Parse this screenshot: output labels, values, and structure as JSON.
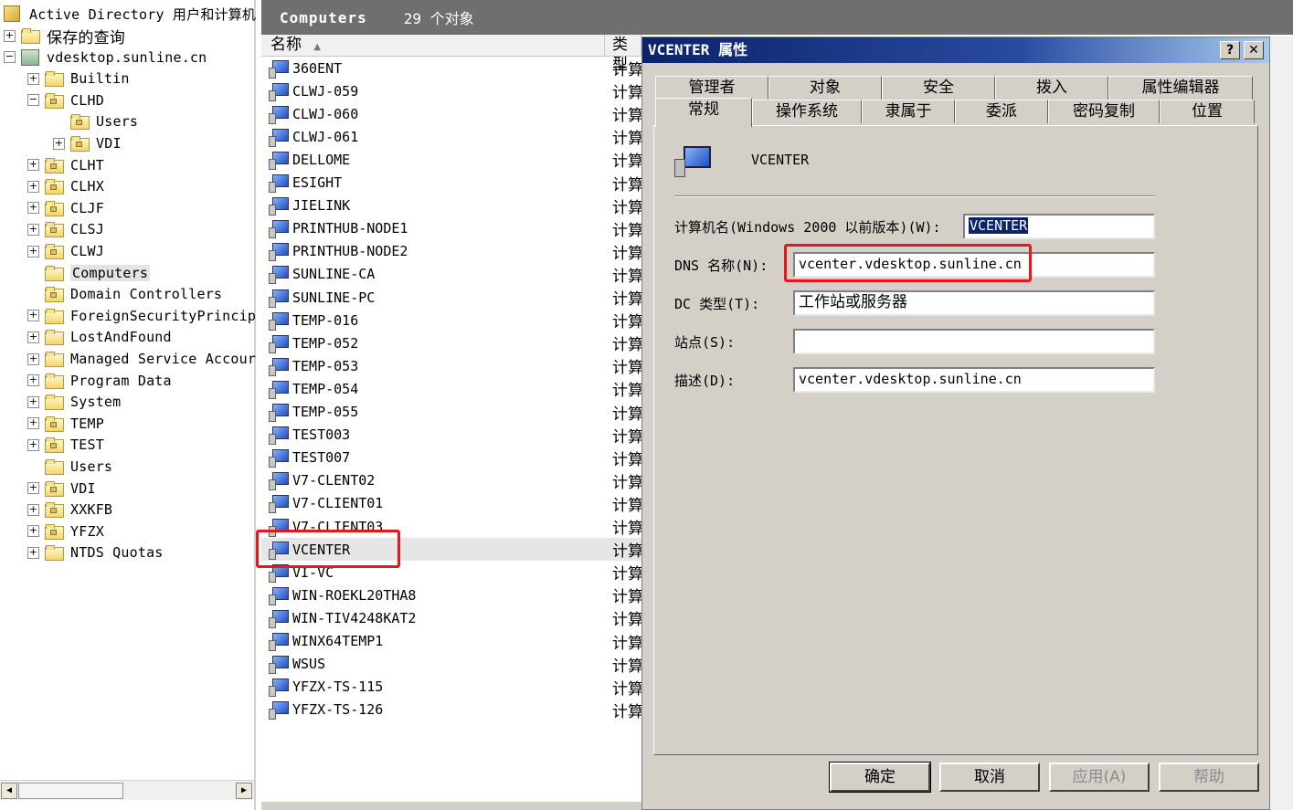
{
  "tree": {
    "root_label": "Active Directory 用户和计算机",
    "items": [
      {
        "label": "保存的查询",
        "exp": "+",
        "indent": 0,
        "icon": "folder-icon"
      },
      {
        "label": "vdesktop.sunline.cn",
        "exp": "-",
        "indent": 0,
        "icon": "domain-icon"
      },
      {
        "label": "Builtin",
        "exp": "+",
        "indent": 1,
        "icon": "folder-icon"
      },
      {
        "label": "CLHD",
        "exp": "-",
        "indent": 1,
        "icon": "ou-icon"
      },
      {
        "label": "Users",
        "exp": "",
        "indent": 2,
        "icon": "ou-icon"
      },
      {
        "label": "VDI",
        "exp": "+",
        "indent": 2,
        "icon": "ou-icon"
      },
      {
        "label": "CLHT",
        "exp": "+",
        "indent": 1,
        "icon": "ou-icon"
      },
      {
        "label": "CLHX",
        "exp": "+",
        "indent": 1,
        "icon": "ou-icon"
      },
      {
        "label": "CLJF",
        "exp": "+",
        "indent": 1,
        "icon": "ou-icon"
      },
      {
        "label": "CLSJ",
        "exp": "+",
        "indent": 1,
        "icon": "ou-icon"
      },
      {
        "label": "CLWJ",
        "exp": "+",
        "indent": 1,
        "icon": "ou-icon"
      },
      {
        "label": "Computers",
        "exp": "",
        "indent": 1,
        "icon": "folder-icon",
        "selected": true
      },
      {
        "label": "Domain Controllers",
        "exp": "",
        "indent": 1,
        "icon": "ou-icon"
      },
      {
        "label": "ForeignSecurityPrincip",
        "exp": "+",
        "indent": 1,
        "icon": "folder-icon"
      },
      {
        "label": "LostAndFound",
        "exp": "+",
        "indent": 1,
        "icon": "folder-icon"
      },
      {
        "label": "Managed Service Accour",
        "exp": "+",
        "indent": 1,
        "icon": "folder-icon"
      },
      {
        "label": "Program Data",
        "exp": "+",
        "indent": 1,
        "icon": "folder-icon"
      },
      {
        "label": "System",
        "exp": "+",
        "indent": 1,
        "icon": "folder-icon"
      },
      {
        "label": "TEMP",
        "exp": "+",
        "indent": 1,
        "icon": "ou-icon"
      },
      {
        "label": "TEST",
        "exp": "+",
        "indent": 1,
        "icon": "ou-icon"
      },
      {
        "label": "Users",
        "exp": "",
        "indent": 1,
        "icon": "folder-icon"
      },
      {
        "label": "VDI",
        "exp": "+",
        "indent": 1,
        "icon": "ou-icon"
      },
      {
        "label": "XXKFB",
        "exp": "+",
        "indent": 1,
        "icon": "ou-icon"
      },
      {
        "label": "YFZX",
        "exp": "+",
        "indent": 1,
        "icon": "ou-icon"
      },
      {
        "label": "NTDS Quotas",
        "exp": "+",
        "indent": 1,
        "icon": "folder-icon"
      }
    ]
  },
  "list": {
    "header_title": "Computers",
    "header_count": "29 个对象",
    "col_name": "名称",
    "col_type": "类型",
    "rows": [
      {
        "name": "360ENT",
        "type": "计算"
      },
      {
        "name": "CLWJ-059",
        "type": "计算"
      },
      {
        "name": "CLWJ-060",
        "type": "计算"
      },
      {
        "name": "CLWJ-061",
        "type": "计算"
      },
      {
        "name": "DELLOME",
        "type": "计算"
      },
      {
        "name": "ESIGHT",
        "type": "计算"
      },
      {
        "name": "JIELINK",
        "type": "计算"
      },
      {
        "name": "PRINTHUB-NODE1",
        "type": "计算"
      },
      {
        "name": "PRINTHUB-NODE2",
        "type": "计算"
      },
      {
        "name": "SUNLINE-CA",
        "type": "计算"
      },
      {
        "name": "SUNLINE-PC",
        "type": "计算"
      },
      {
        "name": "TEMP-016",
        "type": "计算"
      },
      {
        "name": "TEMP-052",
        "type": "计算"
      },
      {
        "name": "TEMP-053",
        "type": "计算"
      },
      {
        "name": "TEMP-054",
        "type": "计算"
      },
      {
        "name": "TEMP-055",
        "type": "计算"
      },
      {
        "name": "TEST003",
        "type": "计算"
      },
      {
        "name": "TEST007",
        "type": "计算"
      },
      {
        "name": "V7-CLENT02",
        "type": "计算"
      },
      {
        "name": "V7-CLIENT01",
        "type": "计算"
      },
      {
        "name": "V7-CLIENT03",
        "type": "计算"
      },
      {
        "name": "VCENTER",
        "type": "计算",
        "selected": true
      },
      {
        "name": "VI-VC",
        "type": "计算"
      },
      {
        "name": "WIN-ROEKL20THA8",
        "type": "计算"
      },
      {
        "name": "WIN-TIV4248KAT2",
        "type": "计算"
      },
      {
        "name": "WINX64TEMP1",
        "type": "计算"
      },
      {
        "name": "WSUS",
        "type": "计算"
      },
      {
        "name": "YFZX-TS-115",
        "type": "计算"
      },
      {
        "name": "YFZX-TS-126",
        "type": "计算"
      }
    ]
  },
  "dialog": {
    "title": "VCENTER 属性",
    "help_btn": "?",
    "close_btn": "✕",
    "tabs_back": [
      "管理者",
      "对象",
      "安全",
      "拨入",
      "属性编辑器"
    ],
    "tabs_front": [
      "常规",
      "操作系统",
      "隶属于",
      "委派",
      "密码复制",
      "位置"
    ],
    "object_name": "VCENTER",
    "fields": {
      "pre2000_label": "计算机名(Windows 2000 以前版本)(W):",
      "pre2000_value": "VCENTER",
      "dns_label": "DNS 名称(N):",
      "dns_value": "vcenter.vdesktop.sunline.cn",
      "dc_type_label": "DC 类型(T):",
      "dc_type_value": "工作站或服务器",
      "site_label": "站点(S):",
      "site_value": "",
      "desc_label": "描述(D):",
      "desc_value": "vcenter.vdesktop.sunline.cn"
    },
    "buttons": {
      "ok": "确定",
      "cancel": "取消",
      "apply": "应用(A)",
      "help": "帮助"
    }
  },
  "colors": {
    "highlight_box": "#e8171d",
    "title_bar": "#0a246a"
  }
}
